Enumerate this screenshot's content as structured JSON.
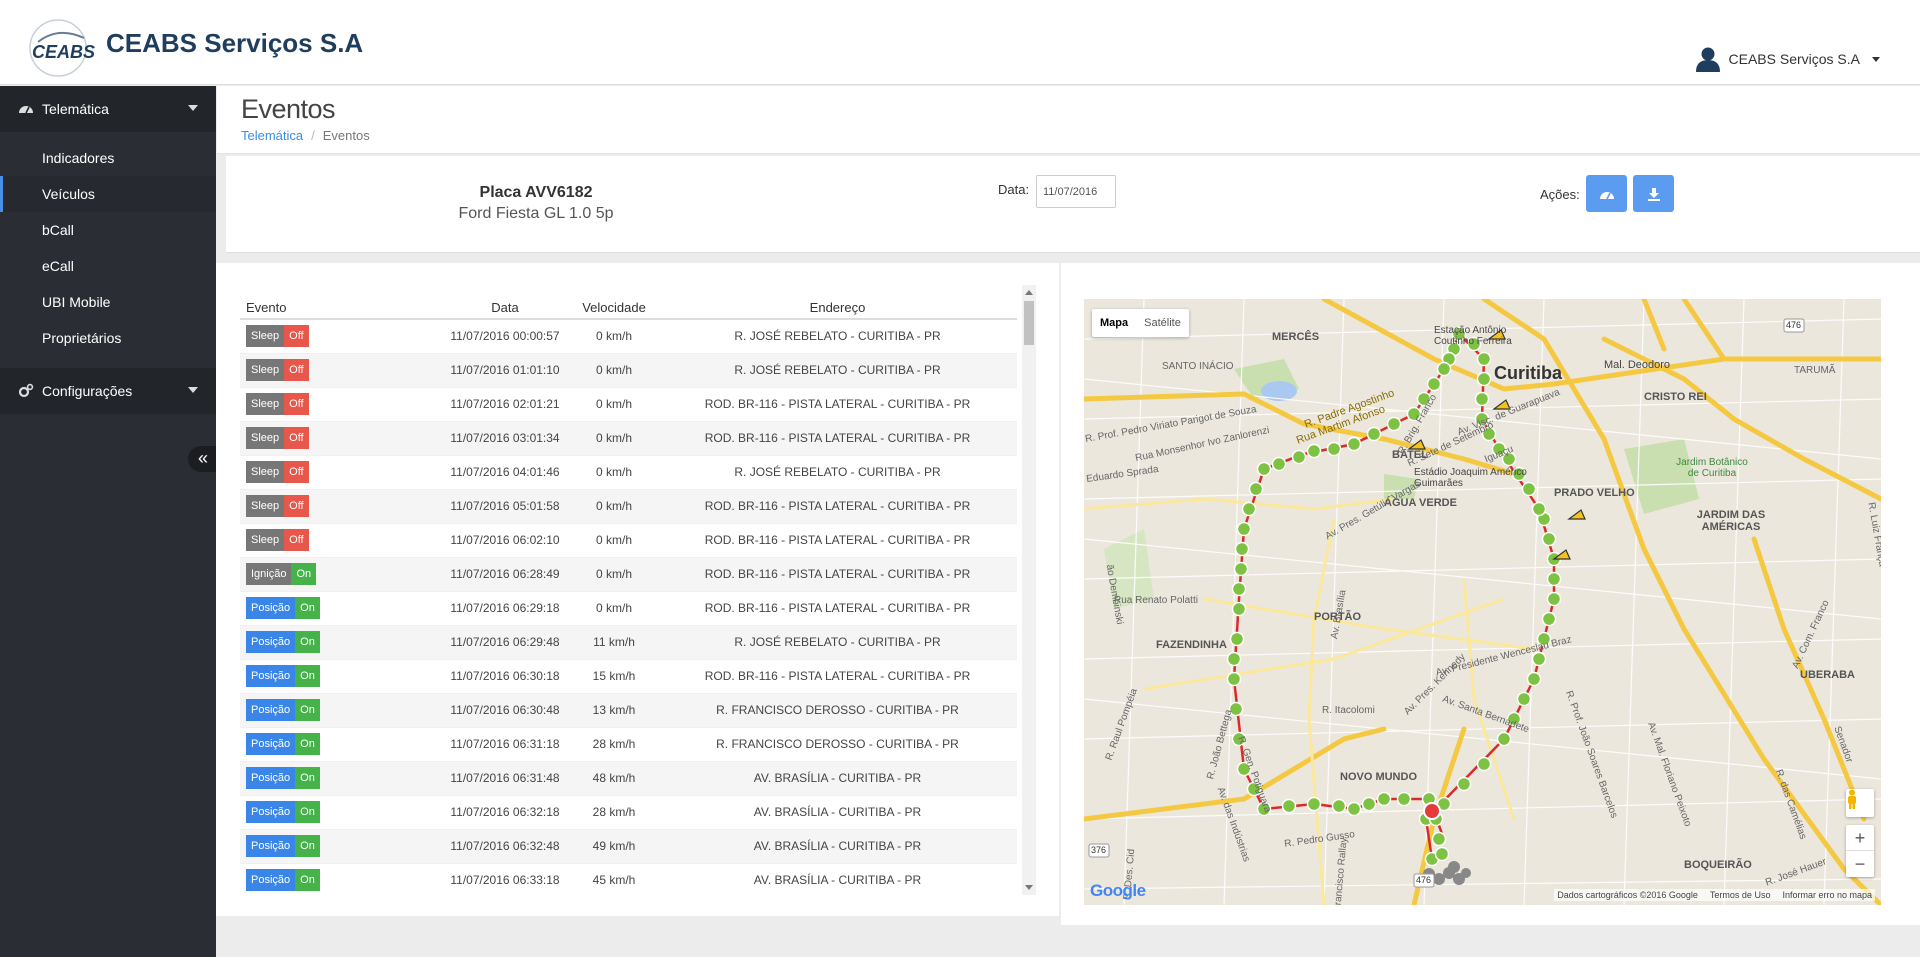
{
  "header": {
    "brand": "CEABS Serviços S.A",
    "logo_text": "CEABS",
    "user": "CEABS Serviços S.A"
  },
  "sidebar": {
    "group1": "Telemática",
    "items": [
      "Indicadores",
      "Veículos",
      "bCall",
      "eCall",
      "UBI Mobile",
      "Proprietários"
    ],
    "active_index": 1,
    "group2": "Configurações",
    "collapse_glyph": "«"
  },
  "page": {
    "title": "Eventos",
    "breadcrumb": [
      "Telemática",
      "Eventos"
    ],
    "breadcrumb_sep": "/"
  },
  "vehicle": {
    "plate": "Placa AVV6182",
    "model": "Ford Fiesta GL 1.0 5p",
    "date_label": "Data:",
    "date_value": "11/07/2016",
    "actions_label": "Ações:"
  },
  "table": {
    "columns": [
      "Evento",
      "Data",
      "Velocidade",
      "Endereço"
    ],
    "rows": [
      {
        "kind": "Sleep",
        "state": "Off",
        "date": "11/07/2016 00:00:57",
        "speed": "0 km/h",
        "address": "R. JOSÉ REBELATO - CURITIBA - PR"
      },
      {
        "kind": "Sleep",
        "state": "Off",
        "date": "11/07/2016 01:01:10",
        "speed": "0 km/h",
        "address": "R. JOSÉ REBELATO - CURITIBA - PR"
      },
      {
        "kind": "Sleep",
        "state": "Off",
        "date": "11/07/2016 02:01:21",
        "speed": "0 km/h",
        "address": "ROD. BR-116 - PISTA LATERAL - CURITIBA - PR"
      },
      {
        "kind": "Sleep",
        "state": "Off",
        "date": "11/07/2016 03:01:34",
        "speed": "0 km/h",
        "address": "ROD. BR-116 - PISTA LATERAL - CURITIBA - PR"
      },
      {
        "kind": "Sleep",
        "state": "Off",
        "date": "11/07/2016 04:01:46",
        "speed": "0 km/h",
        "address": "R. JOSÉ REBELATO - CURITIBA - PR"
      },
      {
        "kind": "Sleep",
        "state": "Off",
        "date": "11/07/2016 05:01:58",
        "speed": "0 km/h",
        "address": "ROD. BR-116 - PISTA LATERAL - CURITIBA - PR"
      },
      {
        "kind": "Sleep",
        "state": "Off",
        "date": "11/07/2016 06:02:10",
        "speed": "0 km/h",
        "address": "ROD. BR-116 - PISTA LATERAL - CURITIBA - PR"
      },
      {
        "kind": "Ignição",
        "state": "On",
        "date": "11/07/2016 06:28:49",
        "speed": "0 km/h",
        "address": "ROD. BR-116 - PISTA LATERAL - CURITIBA - PR"
      },
      {
        "kind": "Posição",
        "state": "On",
        "date": "11/07/2016 06:29:18",
        "speed": "0 km/h",
        "address": "ROD. BR-116 - PISTA LATERAL - CURITIBA - PR"
      },
      {
        "kind": "Posição",
        "state": "On",
        "date": "11/07/2016 06:29:48",
        "speed": "11 km/h",
        "address": "R. JOSÉ REBELATO - CURITIBA - PR"
      },
      {
        "kind": "Posição",
        "state": "On",
        "date": "11/07/2016 06:30:18",
        "speed": "15 km/h",
        "address": "ROD. BR-116 - PISTA LATERAL - CURITIBA - PR"
      },
      {
        "kind": "Posição",
        "state": "On",
        "date": "11/07/2016 06:30:48",
        "speed": "13 km/h",
        "address": "R. FRANCISCO DEROSSO - CURITIBA - PR"
      },
      {
        "kind": "Posição",
        "state": "On",
        "date": "11/07/2016 06:31:18",
        "speed": "28 km/h",
        "address": "R. FRANCISCO DEROSSO - CURITIBA - PR"
      },
      {
        "kind": "Posição",
        "state": "On",
        "date": "11/07/2016 06:31:48",
        "speed": "48 km/h",
        "address": "AV. BRASÍLIA - CURITIBA - PR"
      },
      {
        "kind": "Posição",
        "state": "On",
        "date": "11/07/2016 06:32:18",
        "speed": "28 km/h",
        "address": "AV. BRASÍLIA - CURITIBA - PR"
      },
      {
        "kind": "Posição",
        "state": "On",
        "date": "11/07/2016 06:32:48",
        "speed": "49 km/h",
        "address": "AV. BRASÍLIA - CURITIBA - PR"
      },
      {
        "kind": "Posição",
        "state": "On",
        "date": "11/07/2016 06:33:18",
        "speed": "45 km/h",
        "address": "AV. BRASÍLIA - CURITIBA - PR"
      }
    ]
  },
  "map": {
    "type_options": [
      "Mapa",
      "Satélite"
    ],
    "selected_type": "Mapa",
    "zoom_in": "+",
    "zoom_out": "−",
    "google": "Google",
    "attribution": [
      "Dados cartográficos ©2016 Google",
      "Termos de Uso",
      "Informar erro no mapa"
    ],
    "labels": {
      "city": "Curitiba",
      "mercês": "MERCÊS",
      "santo_inacio": "SANTO INÁCIO",
      "batel": "BATEL",
      "agua_verde": "ÁGUA VERDE",
      "prado_velho": "PRADO VELHO",
      "cristo_rei": "CRISTO REI",
      "jardim_americas": "JARDIM DAS AMÉRICAS",
      "portao": "PORTÃO",
      "fazendinha": "FAZENDINHA",
      "novo_mundo": "NOVO MUNDO",
      "uberaba": "UBERABA",
      "boqueirao": "BOQUEIRÃO",
      "taruma": "TARUMÃ",
      "estadio": "Estádio Joaquim Américo Guimarães",
      "jardim_botanico": "Jardim Botânico de Curitiba",
      "mal_deodoro": "Mal. Deodoro",
      "rua_martim": "Rua Martim Afonso",
      "r_padre": "R. Padre Agostinho",
      "av_brasilia": "Av. Brasília",
      "av_wenceslau": "Av. Presidente Wenceslau Braz",
      "av_kennedy": "Av. Pres. Kennedy",
      "r_renato": "Rua Renato Polatti",
      "r_itacolomi": "R. Itacolomi",
      "av_santa": "Av. Santa Bernadete",
      "r_pedro": "R. Pedro Gusso",
      "av_mal_floriano": "Av. Mal. Floriano Peixoto",
      "r_prof_joao": "R. Prof. João Soares Barcelos",
      "av_com_franco": "Av. Com. Franco",
      "estação": "Estação Antônio Coutinho Ferreira",
      "r_big": "R. Brig. Franco",
      "r_prof_pedro": "R. Prof. Pedro Viriato Parigot de Souza",
      "r_mons": "Rua Monsenhor Ivo Zanlorenzi",
      "r_eduardo": "Eduardo Sprada",
      "av_getulio": "Av. Pres. Getúlio Vargas",
      "r_sete": "R. Sete de Setembro",
      "av_visc": "Av. Visc. de Guarapuava",
      "r_iguacu": "Iguaçu",
      "r_luiz_franca": "R. Luiz França",
      "raul_pompeia": "R. Raul Pompéia",
      "rua_joao": "R. João Bettega",
      "av_ind": "Av. das Indústrias",
      "francisco_rallay": "Francisco Rallay",
      "r_des": "R. Des. Cid",
      "r_gen": "R. Gen. Potiguara",
      "camelias": "R. das Camélias",
      "r_jose_hauer": "R. José Hauer",
      "r_senador": "Senador",
      "dembinski": "ão Dembinski",
      "br376": "376",
      "br476": "476"
    }
  },
  "colors": {
    "sidebar_bg": "#2a2d33",
    "accent_blue": "#3a86e8",
    "off_red": "#e8574b",
    "on_green": "#46b34a",
    "route_green": "#7dc242",
    "route_line": "#d92b2b"
  },
  "icons": {
    "user": "user-icon",
    "telematica": "dashboard-icon",
    "config": "cogs-icon",
    "action1": "dashboard-icon",
    "action2": "download-icon"
  }
}
